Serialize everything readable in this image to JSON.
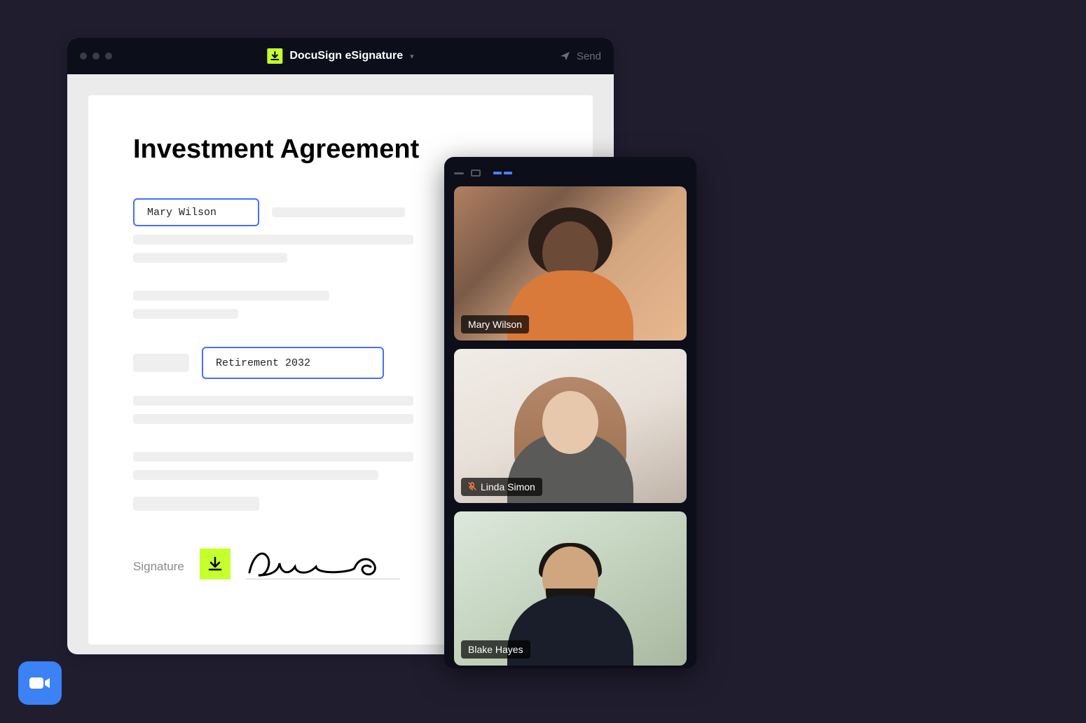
{
  "docusign": {
    "app_name": "DocuSign eSignature",
    "send_label": "Send",
    "document": {
      "title": "Investment Agreement",
      "field1_value": "Mary Wilson",
      "field2_value": "Retirement 2032",
      "signature_label": "Signature"
    }
  },
  "videocall": {
    "participants": [
      {
        "name": "Mary Wilson",
        "muted": false
      },
      {
        "name": "Linda Simon",
        "muted": true
      },
      {
        "name": "Blake Hayes",
        "muted": false
      }
    ]
  },
  "icons": {
    "download": "download-icon",
    "send": "send-icon",
    "chevron": "chevron-down-icon",
    "mute": "microphone-muted-icon",
    "zoom": "zoom-camera-icon"
  },
  "colors": {
    "accent_green": "#c5ff2e",
    "field_border": "#486dff",
    "background": "#201d2f",
    "zoom_blue": "#3b82f6"
  }
}
